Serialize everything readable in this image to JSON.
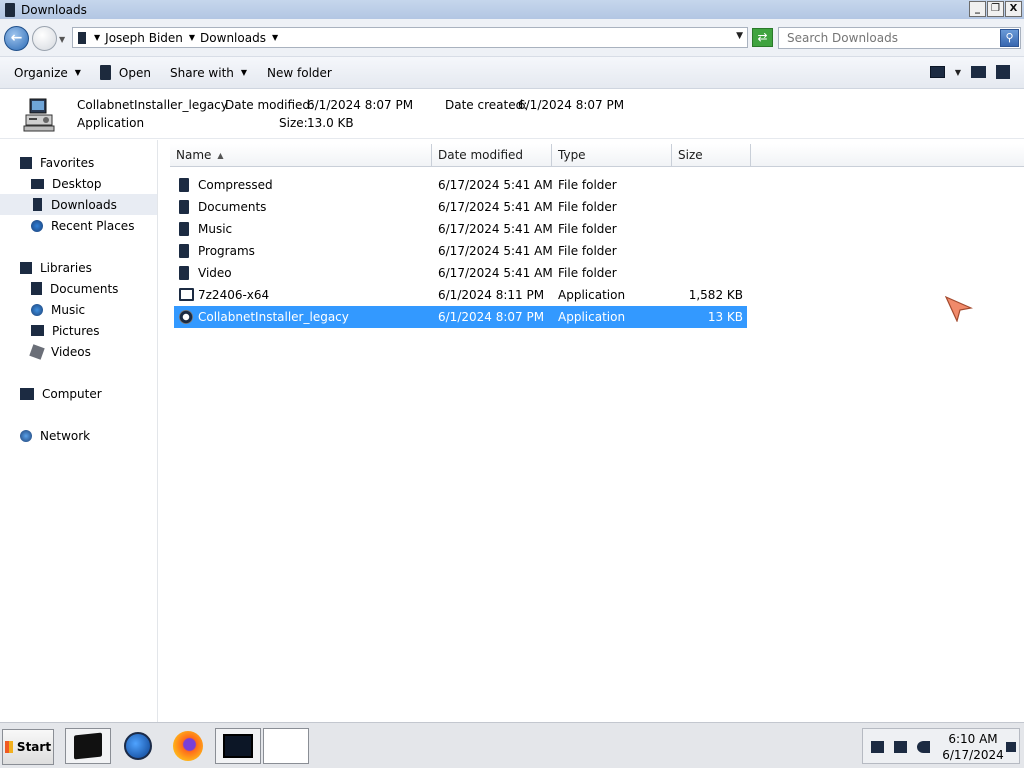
{
  "window": {
    "title": "Downloads",
    "buttons": {
      "minimize": "_",
      "restore": "❐",
      "close": "X"
    }
  },
  "address": {
    "crumbs": [
      "Joseph Biden",
      "Downloads"
    ],
    "search_placeholder": "Search Downloads"
  },
  "toolbar": {
    "organize": "Organize",
    "open": "Open",
    "share_with": "Share with",
    "new_folder": "New folder"
  },
  "details": {
    "name": "CollabnetInstaller_legacy",
    "type": "Application",
    "modified_label": "Date modified:",
    "modified_value": "6/1/2024 8:07 PM",
    "created_label": "Date created:",
    "created_value": "6/1/2024 8:07 PM",
    "size_label": "Size:",
    "size_value": "13.0 KB"
  },
  "nav": {
    "favorites": "Favorites",
    "desktop": "Desktop",
    "downloads": "Downloads",
    "recent": "Recent Places",
    "libraries": "Libraries",
    "documents": "Documents",
    "music": "Music",
    "pictures": "Pictures",
    "videos": "Videos",
    "computer": "Computer",
    "network": "Network"
  },
  "columns": {
    "name": "Name",
    "date": "Date modified",
    "type": "Type",
    "size": "Size"
  },
  "files": [
    {
      "name": "Compressed",
      "date": "6/17/2024 5:41 AM",
      "type": "File folder",
      "size": ""
    },
    {
      "name": "Documents",
      "date": "6/17/2024 5:41 AM",
      "type": "File folder",
      "size": ""
    },
    {
      "name": "Music",
      "date": "6/17/2024 5:41 AM",
      "type": "File folder",
      "size": ""
    },
    {
      "name": "Programs",
      "date": "6/17/2024 5:41 AM",
      "type": "File folder",
      "size": ""
    },
    {
      "name": "Video",
      "date": "6/17/2024 5:41 AM",
      "type": "File folder",
      "size": ""
    },
    {
      "name": "7z2406-x64",
      "date": "6/1/2024 8:11 PM",
      "type": "Application",
      "size": "1,582 KB"
    },
    {
      "name": "CollabnetInstaller_legacy",
      "date": "6/1/2024 8:07 PM",
      "type": "Application",
      "size": "13 KB"
    }
  ],
  "taskbar": {
    "start": "Start",
    "time": "6:10 AM",
    "date": "6/17/2024"
  }
}
